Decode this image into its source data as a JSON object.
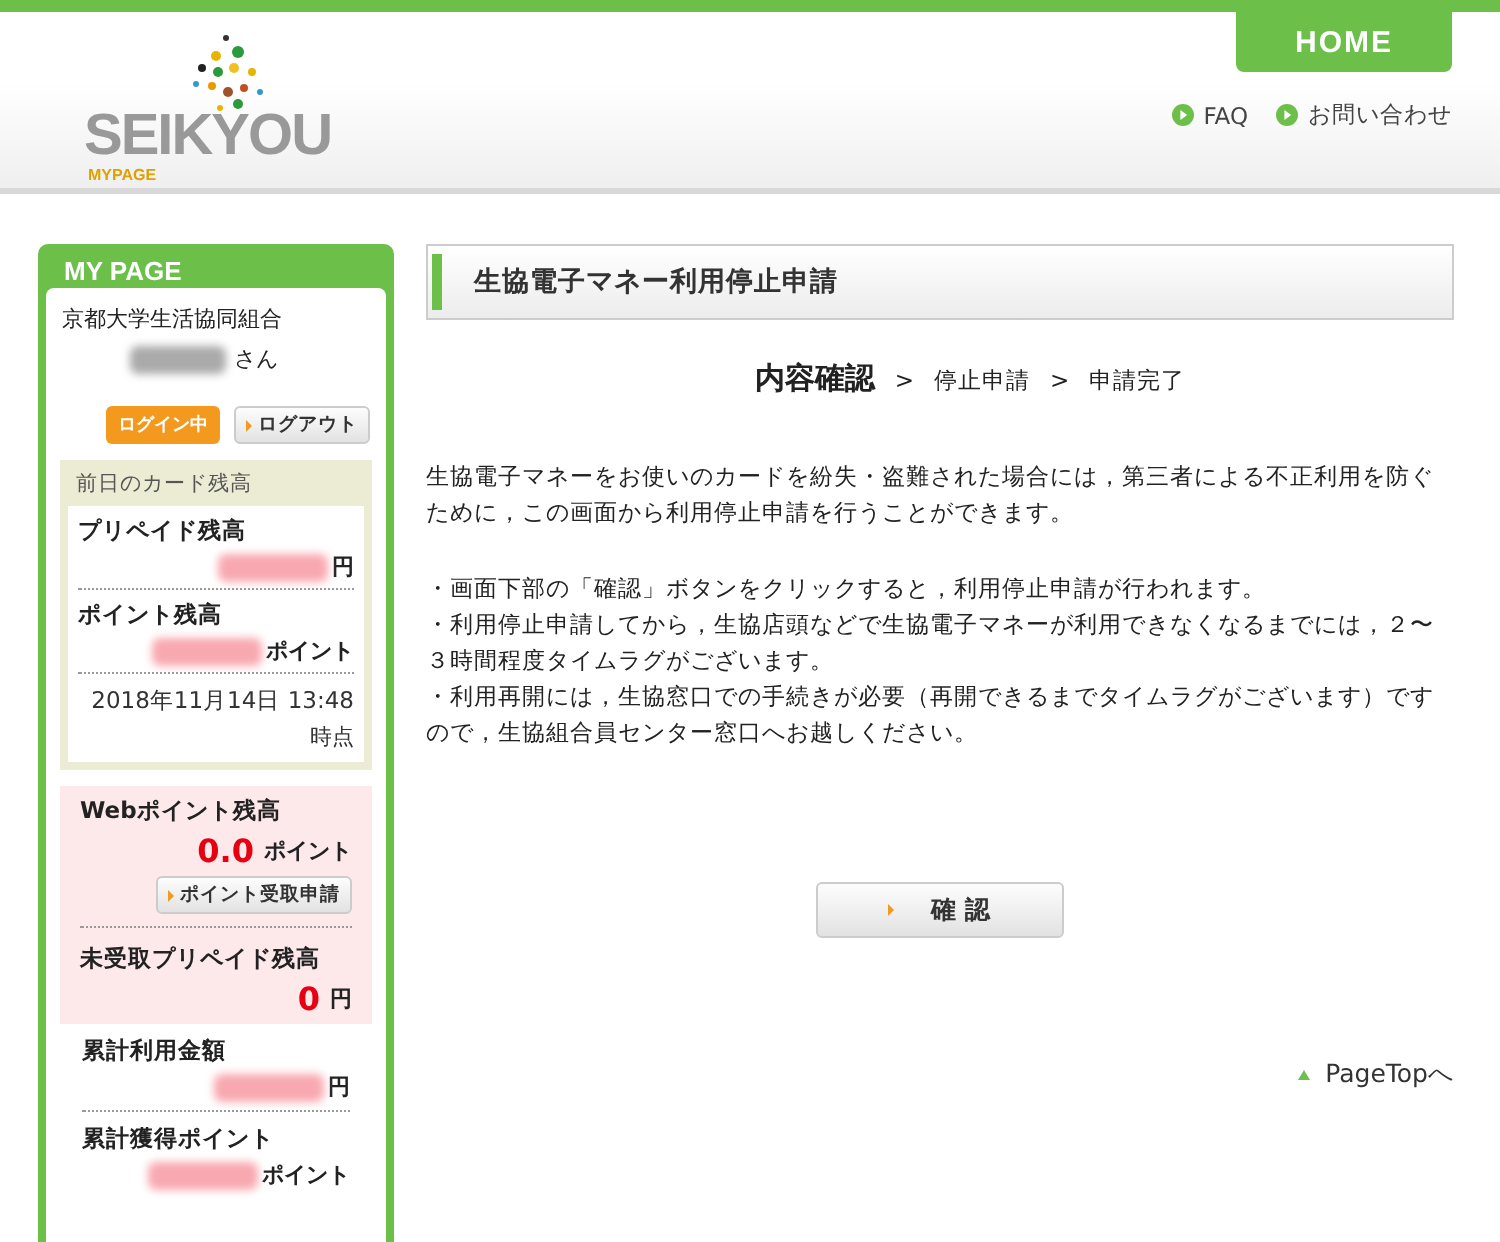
{
  "header": {
    "logo": {
      "wordmark": "SEIKYOU",
      "sub": "MYPAGE"
    },
    "home_tab": "HOME",
    "links": [
      "FAQ",
      "お問い合わせ"
    ]
  },
  "sidebar": {
    "title": "MY PAGE",
    "org": "京都大学生活協同組合",
    "user_suffix": "さん",
    "login_status": "ログイン中",
    "logout_button": "ログアウト",
    "card_balance": {
      "title": "前日のカード残高",
      "items": [
        {
          "label": "プリペイド残高",
          "unit": "円"
        },
        {
          "label": "ポイント残高",
          "unit": "ポイント"
        }
      ],
      "date": "2018年11月14日 13:48",
      "date_suffix": "時点"
    },
    "web": {
      "label": "Webポイント残高",
      "value": "0.0",
      "unit": "ポイント",
      "button": "ポイント受取申請",
      "unreceived_label": "未受取プリペイド残高",
      "unreceived_value": "0",
      "unreceived_unit": "円"
    },
    "totals": [
      {
        "label": "累計利用金額",
        "unit": "円"
      },
      {
        "label": "累計獲得ポイント",
        "unit": "ポイント"
      }
    ]
  },
  "main": {
    "title": "生協電子マネー利用停止申請",
    "steps": [
      {
        "label": "内容確認",
        "selected": true
      },
      {
        "label": "停止申請",
        "selected": false
      },
      {
        "label": "申請完了",
        "selected": false
      }
    ],
    "step_separator": ">",
    "intro": "生協電子マネーをお使いのカードを紛失・盗難された場合には，第三者による不正利用を防ぐために，この画面から利用停止申請を行うことができます。",
    "notes": [
      "・画面下部の「確認」ボタンをクリックすると，利用停止申請が行われます。",
      "・利用停止申請してから，生協店頭などで生協電子マネーが利用できなくなるまでには，２〜３時間程度タイムラグがございます。",
      "・利用再開には，生協窓口での手続きが必要（再開できるまでタイムラグがございます）ですので，生協組合員センター窓口へお越しください。"
    ],
    "confirm_button": "確 認",
    "page_top": "PageTopへ"
  }
}
